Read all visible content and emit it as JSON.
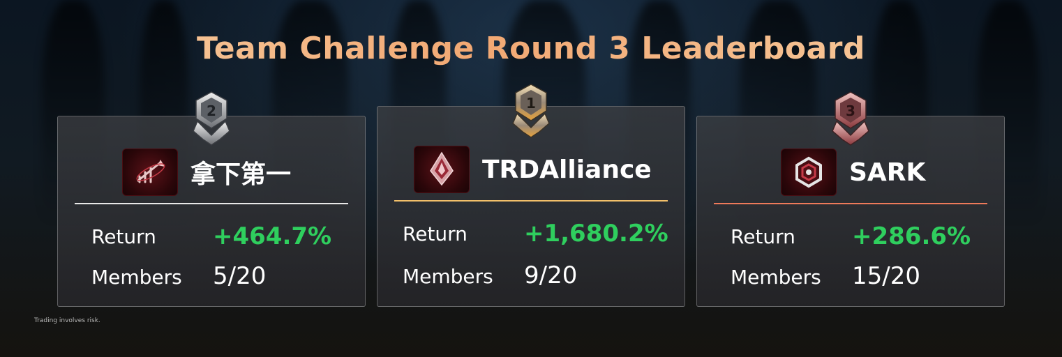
{
  "title": "Team Challenge Round 3 Leaderboard",
  "disclaimer": "Trading involves risk.",
  "colors": {
    "return_positive": "#2fcf5e",
    "title_gradient": [
      "#f8d2a6",
      "#f2a873"
    ]
  },
  "teams": [
    {
      "rank": "2",
      "name": "拿下第一",
      "return_label": "Return",
      "return_value": "+464.7%",
      "members_label": "Members",
      "members_value": "5/20",
      "medal_icon": "silver-rank-2-medal-icon",
      "logo_icon": "rising-arrow-logo-icon",
      "divider_color": "#e8e8e8"
    },
    {
      "rank": "1",
      "name": "TRDAlliance",
      "return_label": "Return",
      "return_value": "+1,680.2%",
      "members_label": "Members",
      "members_value": "9/20",
      "medal_icon": "gold-rank-1-medal-icon",
      "logo_icon": "crystal-gem-logo-icon",
      "divider_color": "#f2c06a"
    },
    {
      "rank": "3",
      "name": "SARK",
      "return_label": "Return",
      "return_value": "+286.6%",
      "members_label": "Members",
      "members_value": "15/20",
      "medal_icon": "bronze-rank-3-medal-icon",
      "logo_icon": "hexagon-logo-icon",
      "divider_color": "#ee7a5a"
    }
  ]
}
